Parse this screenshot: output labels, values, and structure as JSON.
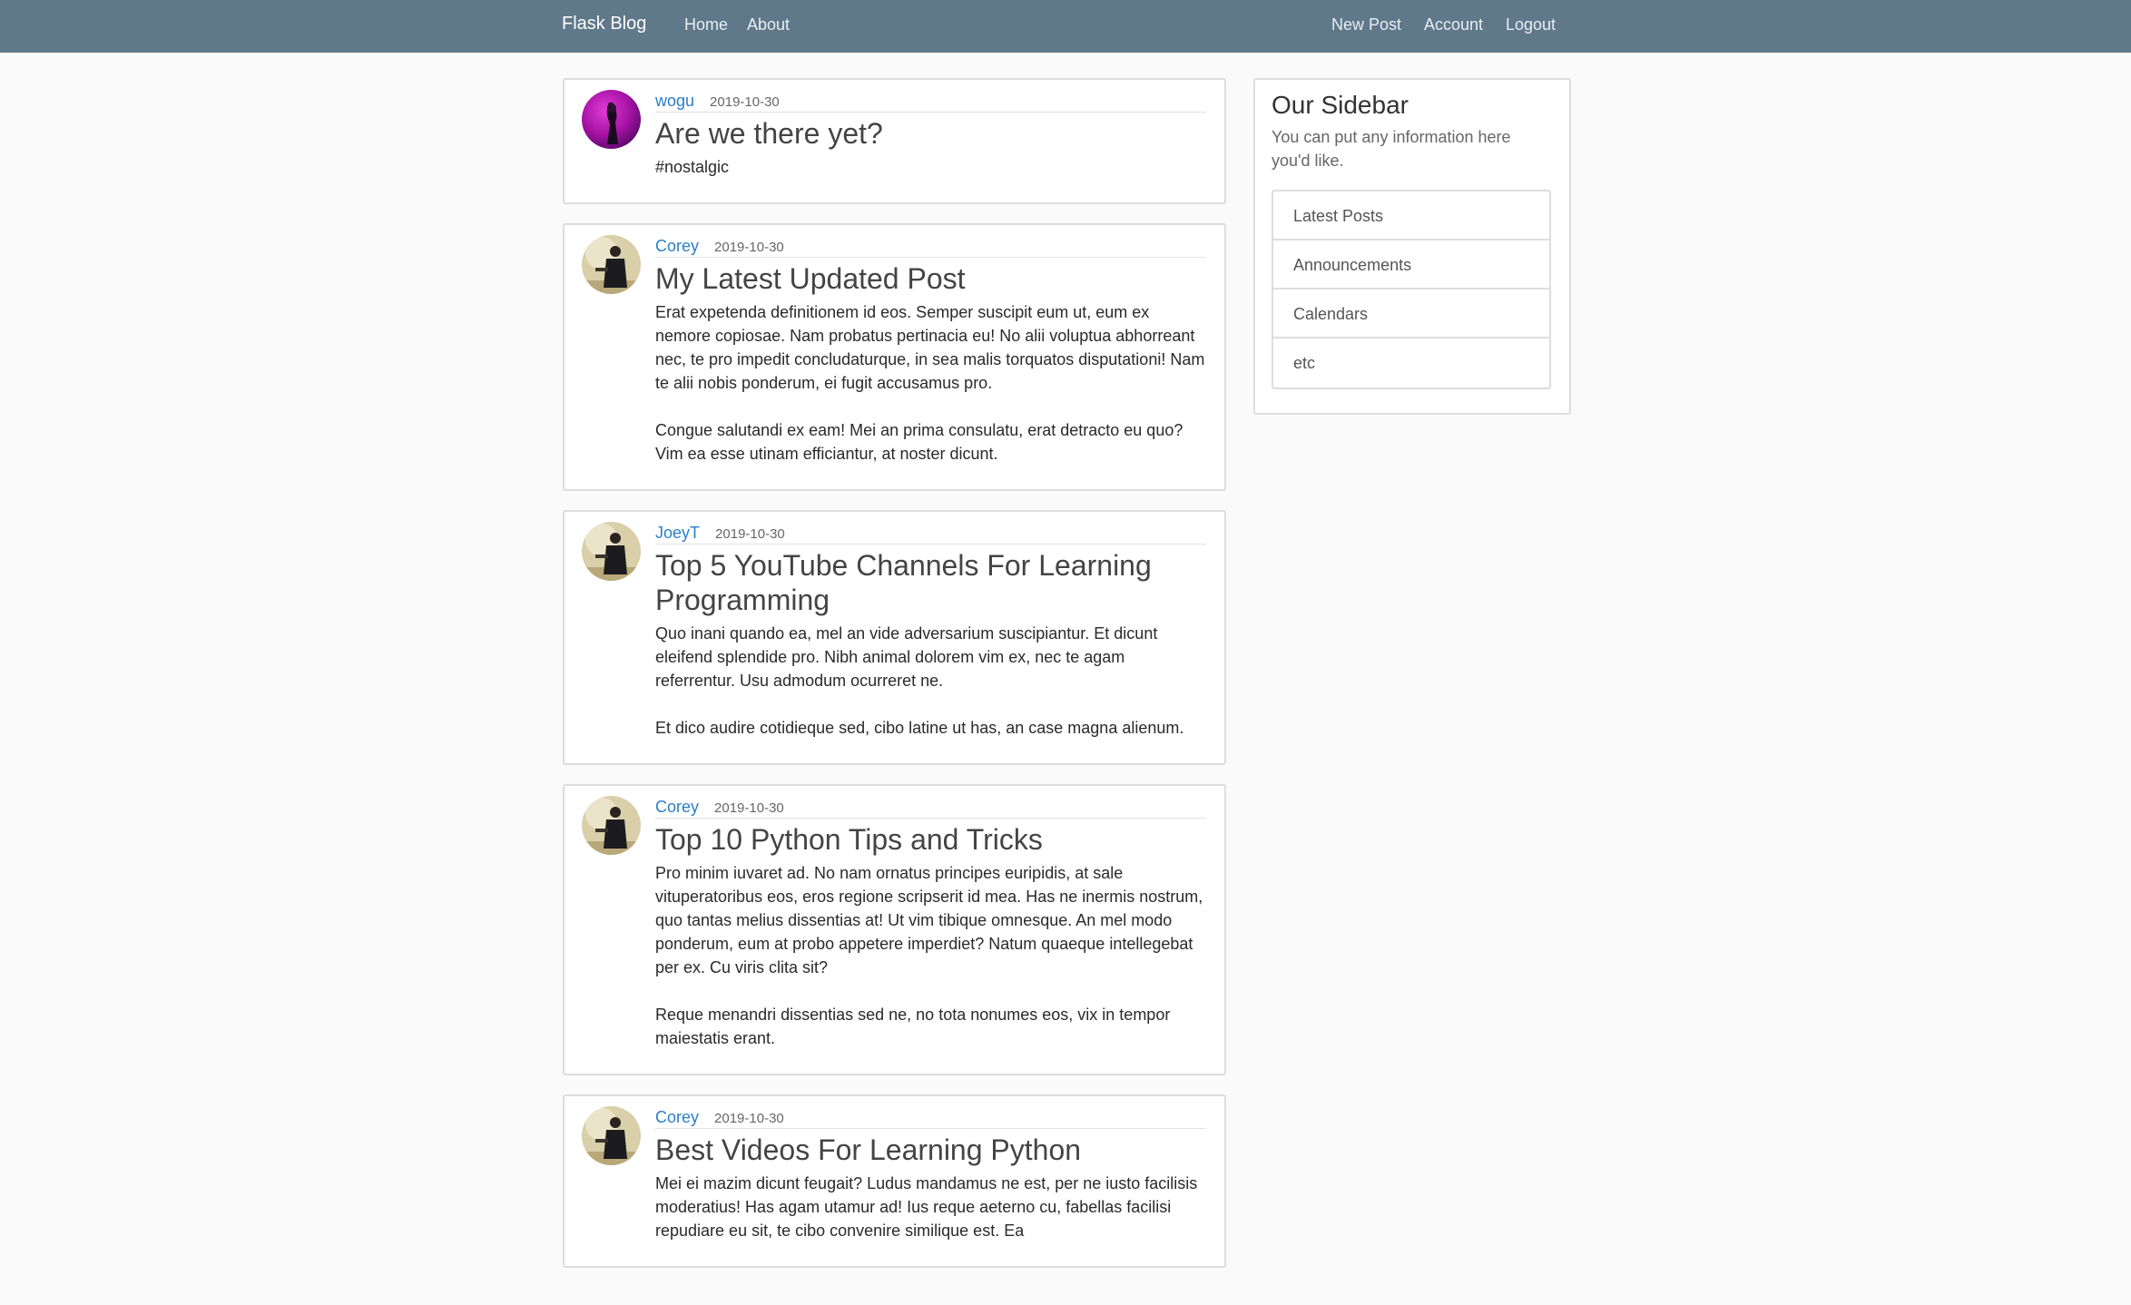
{
  "navbar": {
    "brand": "Flask Blog",
    "left_links": [
      "Home",
      "About"
    ],
    "right_links": [
      "New Post",
      "Account",
      "Logout"
    ]
  },
  "posts": [
    {
      "author": "wogu",
      "date": "2019-10-30",
      "title": "Are we there yet?",
      "content": "#nostalgic",
      "avatar": "purple-portrait"
    },
    {
      "author": "Corey",
      "date": "2019-10-30",
      "title": "My Latest Updated Post",
      "content": "Erat expetenda definitionem id eos. Semper suscipit eum ut, eum ex nemore copiosae. Nam probatus pertinacia eu! No alii voluptua abhorreant nec, te pro impedit concludaturque, in sea malis torquatos disputationi! Nam te alii nobis ponderum, ei fugit accusamus pro.\n\nCongue salutandi ex eam! Mei an prima consulatu, erat detracto eu quo? Vim ea esse utinam efficiantur, at noster dicunt.",
      "avatar": "man-portrait"
    },
    {
      "author": "JoeyT",
      "date": "2019-10-30",
      "title": "Top 5 YouTube Channels For Learning Programming",
      "content": "Quo inani quando ea, mel an vide adversarium suscipiantur. Et dicunt eleifend splendide pro. Nibh animal dolorem vim ex, nec te agam referrentur. Usu admodum ocurreret ne.\n\nEt dico audire cotidieque sed, cibo latine ut has, an case magna alienum.",
      "avatar": "man-portrait"
    },
    {
      "author": "Corey",
      "date": "2019-10-30",
      "title": "Top 10 Python Tips and Tricks",
      "content": "Pro minim iuvaret ad. No nam ornatus principes euripidis, at sale vituperatoribus eos, eros regione scripserit id mea. Has ne inermis nostrum, quo tantas melius dissentias at! Ut vim tibique omnesque. An mel modo ponderum, eum at probo appetere imperdiet? Natum quaeque intellegebat per ex. Cu viris clita sit?\n\nReque menandri dissentias sed ne, no tota nonumes eos, vix in tempor maiestatis erant.",
      "avatar": "man-portrait"
    },
    {
      "author": "Corey",
      "date": "2019-10-30",
      "title": "Best Videos For Learning Python",
      "content": "Mei ei mazim dicunt feugait? Ludus mandamus ne est, per ne iusto facilisis moderatius! Has agam utamur ad! Ius reque aeterno cu, fabellas facilisi repudiare eu sit, te cibo convenire similique est. Ea",
      "avatar": "man-portrait"
    }
  ],
  "sidebar": {
    "title": "Our Sidebar",
    "text": "You can put any information here you'd like.",
    "items": [
      "Latest Posts",
      "Announcements",
      "Calendars",
      "etc"
    ]
  },
  "colors": {
    "navbar": "#5f788a",
    "link": "#2b7ec7",
    "background": "#fafafa"
  }
}
